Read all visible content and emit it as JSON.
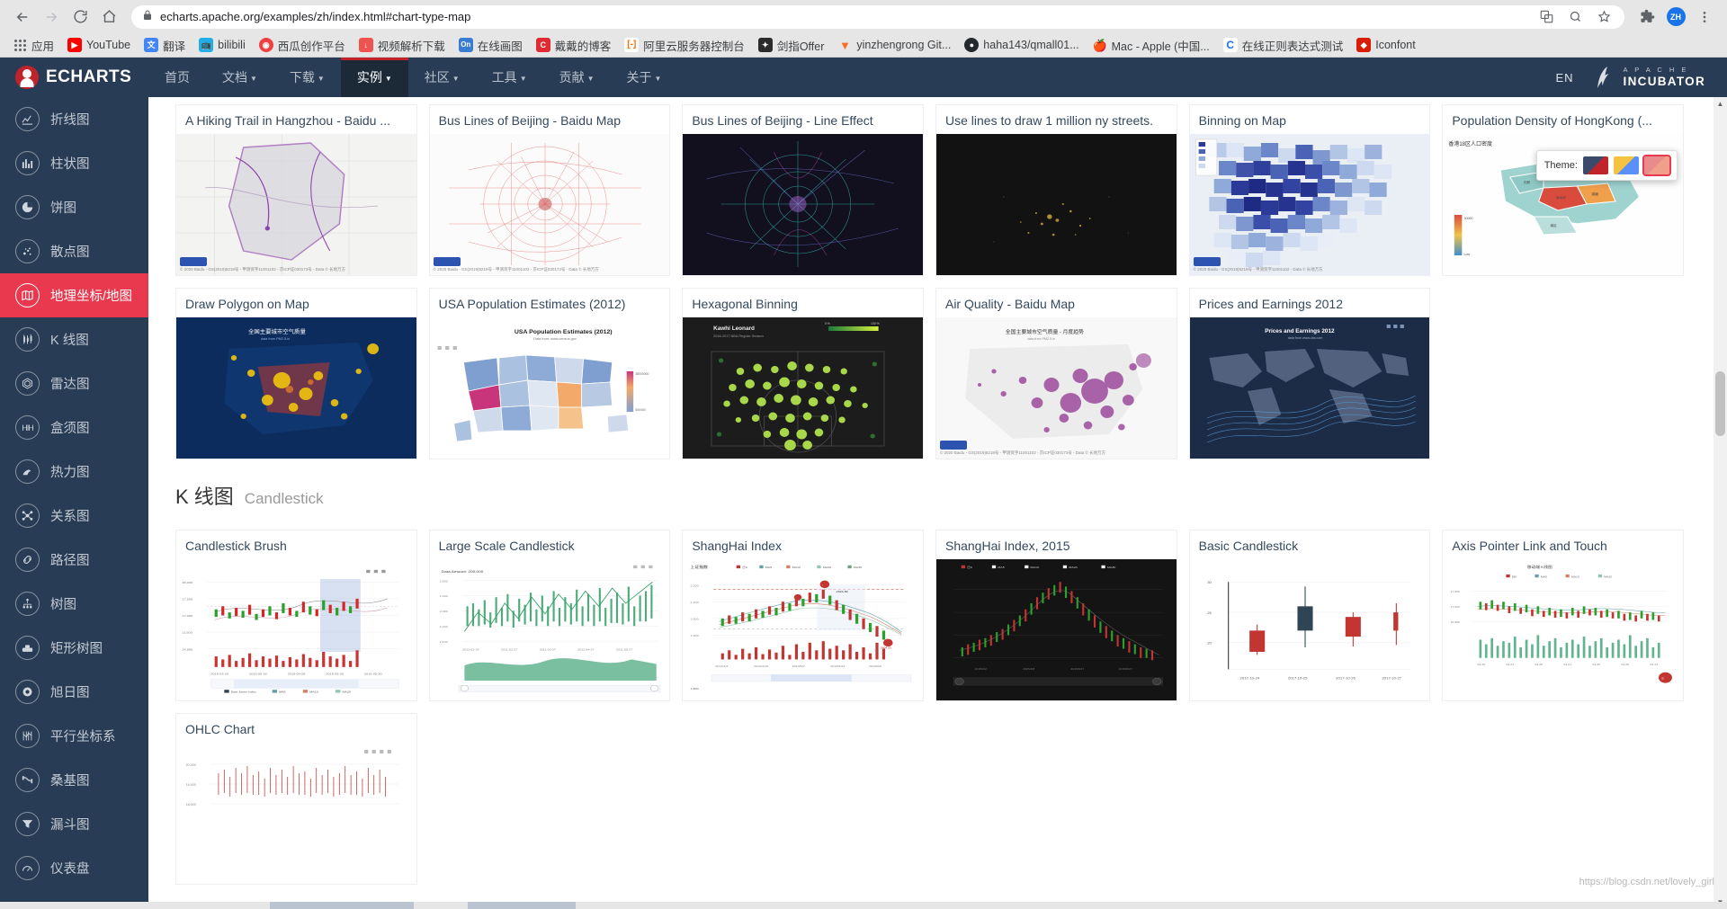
{
  "browser": {
    "back_icon": "back-arrow-icon",
    "forward_icon": "forward-arrow-icon",
    "reload_icon": "reload-icon",
    "home_icon": "home-icon",
    "url": "echarts.apache.org/examples/zh/index.html#chart-type-map",
    "lock_icon": "lock-icon",
    "translate_icon": "translate-icon",
    "search_icon": "search-icon",
    "star_icon": "star-icon",
    "extensions_icon": "puzzle-icon",
    "menu_icon": "kebab-menu-icon",
    "profile_initials": "ZH",
    "bookmarks": [
      {
        "label": "应用",
        "favicon": "apps-grid-icon",
        "color": "#5f6368"
      },
      {
        "label": "YouTube",
        "favicon": "youtube-icon",
        "color": "#ff0000",
        "glyph": "▶"
      },
      {
        "label": "翻译",
        "favicon": "translate-icon",
        "color": "#4285f4",
        "glyph": "文"
      },
      {
        "label": "bilibili",
        "favicon": "bilibili-icon",
        "color": "#23ade5",
        "glyph": "tv"
      },
      {
        "label": "西瓜创作平台",
        "favicon": "xigua-icon",
        "color": "#f04142",
        "glyph": "◉"
      },
      {
        "label": "视频解析下载",
        "favicon": "download-icon",
        "color": "#ef5350",
        "glyph": "↓"
      },
      {
        "label": "在线画图",
        "favicon": "online-draw-icon",
        "color": "#3b7cd3",
        "glyph": "On"
      },
      {
        "label": "戴戴的博客",
        "favicon": "blog-icon",
        "color": "#e02b32",
        "glyph": "C"
      },
      {
        "label": "阿里云服务器控制台",
        "favicon": "aliyun-icon",
        "color": "#ff6a00",
        "glyph": "[-]"
      },
      {
        "label": "剑指Offer",
        "favicon": "offer-icon",
        "color": "#2b2b2b",
        "glyph": "✦"
      },
      {
        "label": "yinzhengrong Git...",
        "favicon": "gitlab-icon",
        "color": "#fc6d26",
        "glyph": "🦊"
      },
      {
        "label": "haha143/qmall01...",
        "favicon": "github-icon",
        "color": "#24292e",
        "glyph": ""
      },
      {
        "label": "Mac - Apple (中国...",
        "favicon": "apple-icon",
        "color": "#555",
        "glyph": ""
      },
      {
        "label": "在线正则表达式测试",
        "favicon": "regex-icon",
        "color": "#1a73e8",
        "glyph": "C"
      },
      {
        "label": "Iconfont",
        "favicon": "iconfont-icon",
        "color": "#d81e06",
        "glyph": "◆"
      }
    ]
  },
  "site": {
    "brand": "ECHARTS",
    "brand_logo": "echarts-logo-icon",
    "nav": [
      {
        "label": "首页",
        "has_caret": false,
        "active": false
      },
      {
        "label": "文档",
        "has_caret": true,
        "active": false
      },
      {
        "label": "下载",
        "has_caret": true,
        "active": false
      },
      {
        "label": "实例",
        "has_caret": true,
        "active": true
      },
      {
        "label": "社区",
        "has_caret": true,
        "active": false
      },
      {
        "label": "工具",
        "has_caret": true,
        "active": false
      },
      {
        "label": "贡献",
        "has_caret": true,
        "active": false
      },
      {
        "label": "关于",
        "has_caret": true,
        "active": false
      }
    ],
    "lang": "EN",
    "incubator_line1": "A P A C H E",
    "incubator_line2": "INCUBATOR",
    "feather_icon": "apache-feather-icon"
  },
  "sidebar": {
    "items": [
      {
        "label": "折线图",
        "icon": "line-chart-icon",
        "active": false
      },
      {
        "label": "柱状图",
        "icon": "bar-chart-icon",
        "active": false
      },
      {
        "label": "饼图",
        "icon": "pie-chart-icon",
        "active": false
      },
      {
        "label": "散点图",
        "icon": "scatter-chart-icon",
        "active": false
      },
      {
        "label": "地理坐标/地图",
        "icon": "map-icon",
        "active": true
      },
      {
        "label": "K 线图",
        "icon": "candlestick-icon",
        "active": false
      },
      {
        "label": "雷达图",
        "icon": "radar-icon",
        "active": false
      },
      {
        "label": "盒须图",
        "icon": "boxplot-icon",
        "active": false
      },
      {
        "label": "热力图",
        "icon": "heatmap-icon",
        "active": false
      },
      {
        "label": "关系图",
        "icon": "graph-icon",
        "active": false
      },
      {
        "label": "路径图",
        "icon": "lines-icon",
        "active": false
      },
      {
        "label": "树图",
        "icon": "tree-icon",
        "active": false
      },
      {
        "label": "矩形树图",
        "icon": "treemap-icon",
        "active": false
      },
      {
        "label": "旭日图",
        "icon": "sunburst-icon",
        "active": false
      },
      {
        "label": "平行坐标系",
        "icon": "parallel-icon",
        "active": false
      },
      {
        "label": "桑基图",
        "icon": "sankey-icon",
        "active": false
      },
      {
        "label": "漏斗图",
        "icon": "funnel-icon",
        "active": false
      },
      {
        "label": "仪表盘",
        "icon": "gauge-icon",
        "active": false
      }
    ]
  },
  "gallery": {
    "map_row1": [
      {
        "title": "A Hiking Trail in Hangzhou - Baidu ...",
        "thumb": "hiking-trail-map"
      },
      {
        "title": "Bus Lines of Beijing - Baidu Map",
        "thumb": "bus-lines-baidu"
      },
      {
        "title": "Bus Lines of Beijing - Line Effect",
        "thumb": "bus-lines-effect"
      },
      {
        "title": "Use lines to draw 1 million ny streets.",
        "thumb": "ny-streets"
      },
      {
        "title": "Binning on Map",
        "thumb": "binning-map"
      },
      {
        "title": "Population Density of HongKong (...",
        "thumb": "hongkong-density"
      }
    ],
    "map_row2": [
      {
        "title": "Draw Polygon on Map",
        "thumb": "draw-polygon"
      },
      {
        "title": "USA Population Estimates (2012)",
        "thumb": "usa-population"
      },
      {
        "title": "Hexagonal Binning",
        "thumb": "hex-binning"
      },
      {
        "title": "Air Quality - Baidu Map",
        "thumb": "air-quality"
      },
      {
        "title": "Prices and Earnings 2012",
        "thumb": "prices-earnings"
      }
    ],
    "candlestick_section": {
      "cn": "K 线图",
      "en": "Candlestick"
    },
    "candlestick_row": [
      {
        "title": "Candlestick Brush",
        "thumb": "candlestick-brush"
      },
      {
        "title": "Large Scale Candlestick",
        "thumb": "large-scale-candlestick"
      },
      {
        "title": "ShangHai Index",
        "thumb": "shanghai-index"
      },
      {
        "title": "ShangHai Index, 2015",
        "thumb": "shanghai-index-2015"
      },
      {
        "title": "Basic Candlestick",
        "thumb": "basic-candlestick"
      },
      {
        "title": "Axis Pointer Link and Touch",
        "thumb": "axis-pointer-link"
      }
    ],
    "candlestick_row2": [
      {
        "title": "OHLC Chart",
        "thumb": "ohlc-chart"
      }
    ]
  },
  "hk_theme_popup": {
    "label": "Theme:",
    "swatches": [
      "#3b4a6b",
      "#5b8ff9",
      "#e88b8b"
    ],
    "selected_index": 2
  },
  "thumb_text": {
    "usa_title": "USA Population Estimates (2012)",
    "usa_sub": "Data from: www.census.gov",
    "hex_title": "Kawhi Leonard",
    "hex_sub": "2016-2017 NBA Regular Season",
    "prices_title": "Prices and Earnings 2012",
    "air_title": "全国主要城市空气质量 - 月度趋势",
    "hk_title": "香港18区人口密度",
    "polygon_title": "全国主要城市空气质量",
    "polygon_sub": "data from PM2.5.in",
    "shanghai_title": "上证指数",
    "shanghai_legend": [
      "日K",
      "MA5",
      "MA10",
      "MA20",
      "MA30"
    ],
    "large_scale_note": "Data Amount: 200,000",
    "axis_pointer_title": "移动端 K线图"
  },
  "watermark": "https://blog.csdn.net/lovely_girl",
  "scrollbar": {
    "up_arrow": "chevron-up-icon",
    "down_arrow": "chevron-down-icon"
  }
}
